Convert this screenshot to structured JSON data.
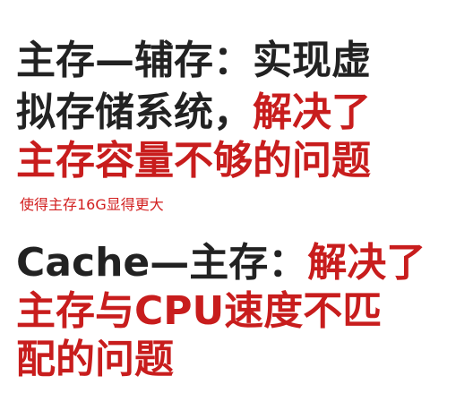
{
  "block1": {
    "line1": {
      "black": "主存—辅存：实现虚"
    },
    "line2": {
      "black": "拟存储系统，",
      "red": "解决了"
    },
    "line3": {
      "red": "主存容量不够的问题"
    }
  },
  "note": "使得主存16G显得更大",
  "block2": {
    "line1": {
      "black": "Cache—主存：",
      "red": "解决了"
    },
    "line2": {
      "red": "主存与CPU速度不匹"
    },
    "line3": {
      "red": "配的问题"
    }
  },
  "colors": {
    "text": "#222222",
    "accent": "#c81d1d"
  }
}
